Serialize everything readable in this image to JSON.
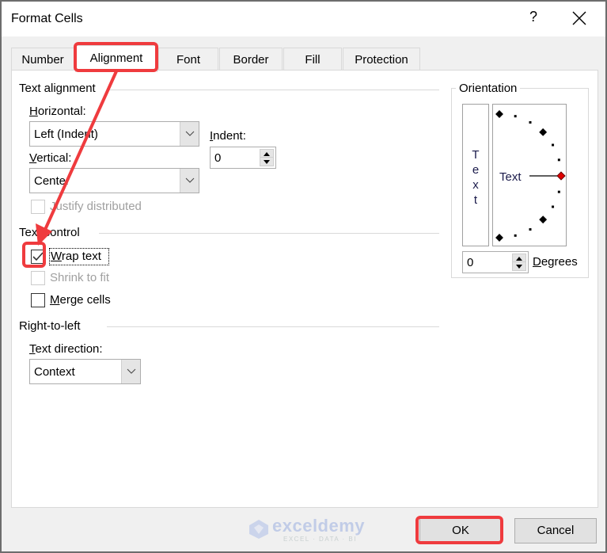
{
  "window": {
    "title": "Format Cells",
    "help_label": "?",
    "close_icon": "close-icon"
  },
  "tabs": [
    {
      "label": "Number",
      "active": false
    },
    {
      "label": "Alignment",
      "active": true
    },
    {
      "label": "Font",
      "active": false
    },
    {
      "label": "Border",
      "active": false
    },
    {
      "label": "Fill",
      "active": false
    },
    {
      "label": "Protection",
      "active": false
    }
  ],
  "text_alignment": {
    "group_label": "Text alignment",
    "horizontal_label": "Horizontal:",
    "horizontal_value": "Left (Indent)",
    "vertical_label": "Vertical:",
    "vertical_value": "Center",
    "indent_label": "Indent:",
    "indent_value": "0",
    "justify_distributed_label": "Justify distributed",
    "justify_distributed_checked": false,
    "justify_distributed_enabled": false
  },
  "text_control": {
    "group_label": "Text control",
    "wrap_text_label": "Wrap text",
    "wrap_text_checked": true,
    "shrink_to_fit_label": "Shrink to fit",
    "shrink_to_fit_checked": false,
    "shrink_to_fit_enabled": false,
    "merge_cells_label": "Merge cells",
    "merge_cells_checked": false
  },
  "right_to_left": {
    "group_label": "Right-to-left",
    "text_direction_label": "Text direction:",
    "text_direction_value": "Context"
  },
  "orientation": {
    "group_label": "Orientation",
    "vertical_text_letters": [
      "T",
      "e",
      "x",
      "t"
    ],
    "dial_text": "Text",
    "degrees_value": "0",
    "degrees_label": "Degrees",
    "selected_angle_deg": 0
  },
  "footer": {
    "ok_label": "OK",
    "cancel_label": "Cancel"
  },
  "watermark": {
    "name": "exceldemy",
    "tagline": "EXCEL · DATA · BI"
  },
  "annotations": {
    "highlight_color": "#ef3b3e"
  }
}
